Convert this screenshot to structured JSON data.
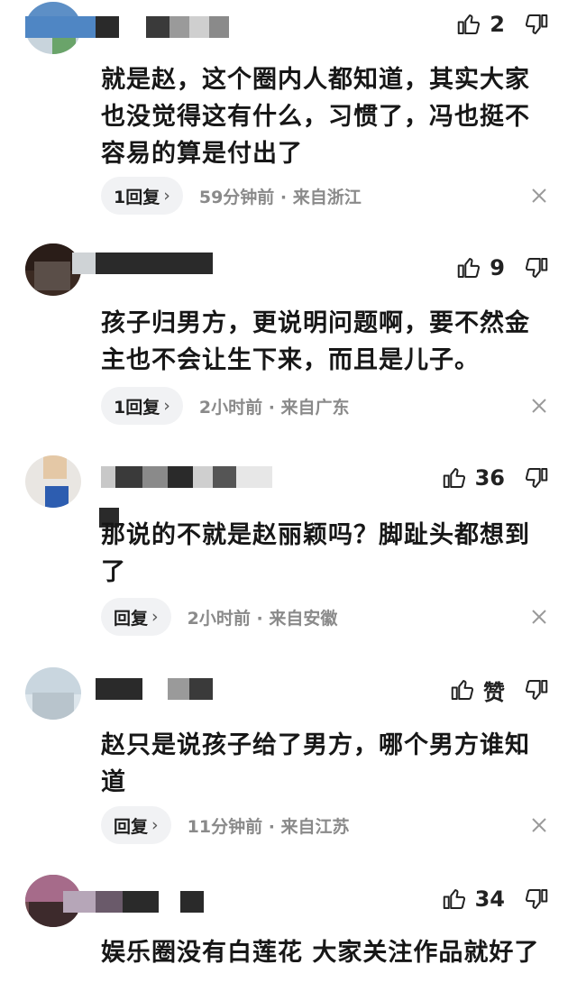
{
  "comments": [
    {
      "likes": "2",
      "text": "就是赵，这个圈内人都知道，其实大家也没觉得这有什么，习惯了，冯也挺不容易的算是付出了",
      "reply_label": "1回复",
      "time": "59分钟前",
      "location": "来自浙江"
    },
    {
      "likes": "9",
      "text": "孩子归男方，更说明问题啊，要不然金主也不会让生下来，而且是儿子。",
      "reply_label": "1回复",
      "time": "2小时前",
      "location": "来自广东"
    },
    {
      "likes": "36",
      "text": "那说的不就是赵丽颖吗？脚趾头都想到了",
      "reply_label": "回复",
      "time": "2小时前",
      "location": "来自安徽"
    },
    {
      "likes": "赞",
      "text": "赵只是说孩子给了男方，哪个男方谁知道",
      "reply_label": "回复",
      "time": "11分钟前",
      "location": "来自江苏"
    },
    {
      "likes": "34",
      "text": "娱乐圈没有白莲花 大家关注作品就好了"
    }
  ],
  "icons": {
    "like": "thumbs-up-icon",
    "dislike": "thumbs-down-icon",
    "reply_chevron": "›",
    "close": "close-icon"
  },
  "separator": "·"
}
